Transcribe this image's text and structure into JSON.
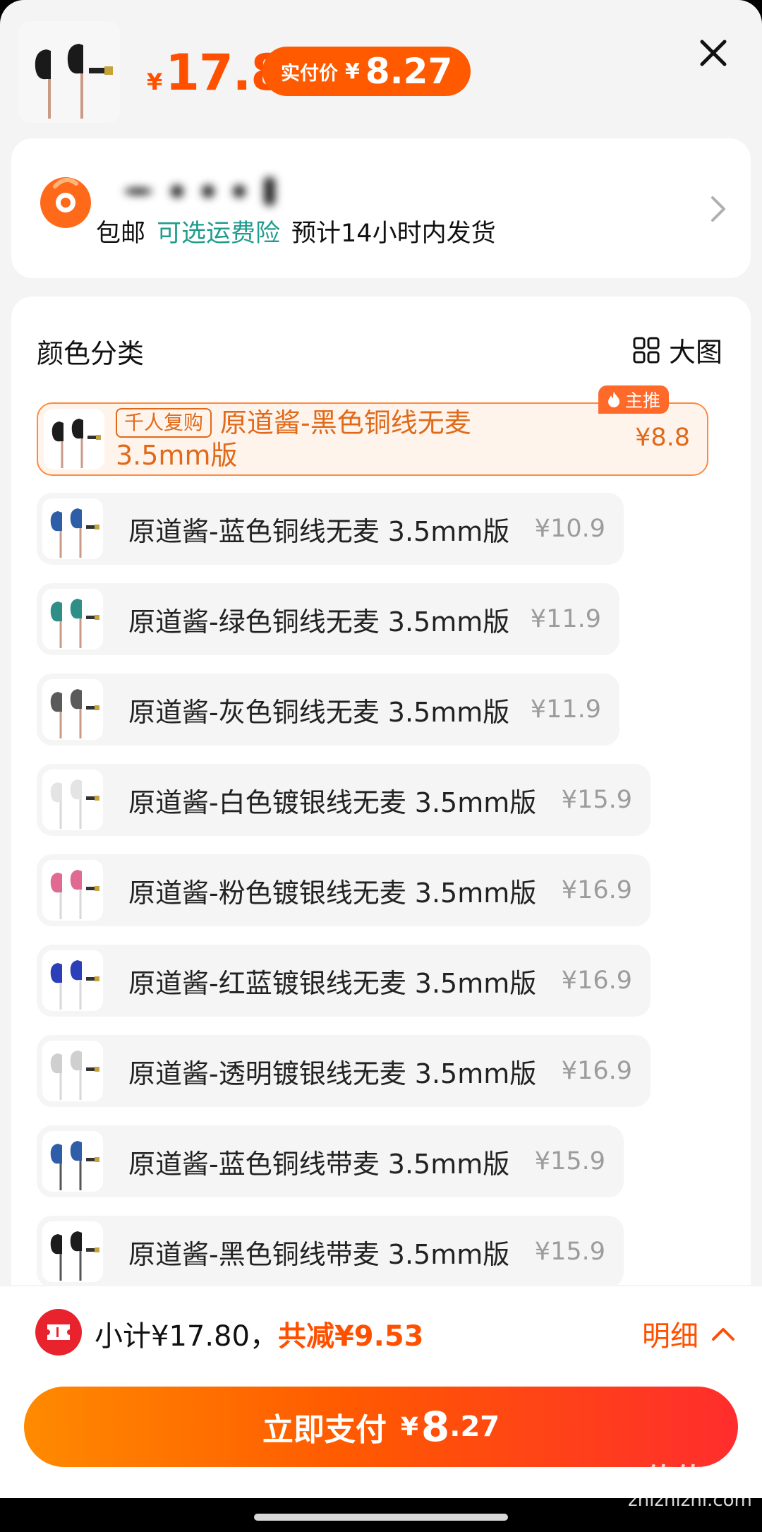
{
  "header": {
    "price_currency": "¥",
    "price": "17.8",
    "pay_label": "实付价",
    "pay_currency": "¥",
    "pay_price": "8.27"
  },
  "shipping": {
    "free_shipping": "包邮",
    "insurance": "可选运费险",
    "eta": "预计14小时内发货"
  },
  "options": {
    "section_title": "颜色分类",
    "big_view_label": "大图",
    "main_badge": "主推",
    "rebuy_tag": "千人复购",
    "items": [
      {
        "name": "原道酱-黑色铜线无麦\n3.5mm版",
        "price": "¥8.8",
        "swatch": "#1c1c1c",
        "wire": "#c99a86"
      },
      {
        "name": "原道酱-蓝色铜线无麦 3.5mm版",
        "price": "¥10.9",
        "swatch": "#2f5ea8",
        "wire": "#c99a86"
      },
      {
        "name": "原道酱-绿色铜线无麦 3.5mm版",
        "price": "¥11.9",
        "swatch": "#2f8f86",
        "wire": "#c99a86"
      },
      {
        "name": "原道酱-灰色铜线无麦 3.5mm版",
        "price": "¥11.9",
        "swatch": "#5a5a5a",
        "wire": "#c99a86"
      },
      {
        "name": "原道酱-白色镀银线无麦 3.5mm版",
        "price": "¥15.9",
        "swatch": "#e4e4e4",
        "wire": "#d8d8d8"
      },
      {
        "name": "原道酱-粉色镀银线无麦 3.5mm版",
        "price": "¥16.9",
        "swatch": "#e16a92",
        "wire": "#d8d8d8"
      },
      {
        "name": "原道酱-红蓝镀银线无麦 3.5mm版",
        "price": "¥16.9",
        "swatch": "#2a3fb8",
        "wire": "#d8d8d8"
      },
      {
        "name": "原道酱-透明镀银线无麦 3.5mm版",
        "price": "¥16.9",
        "swatch": "#cfcfcf",
        "wire": "#d8d8d8"
      },
      {
        "name": "原道酱-蓝色铜线带麦 3.5mm版",
        "price": "¥15.9",
        "swatch": "#2f5ea8",
        "wire": "#555555"
      },
      {
        "name": "原道酱-黑色铜线带麦 3.5mm版",
        "price": "¥15.9",
        "swatch": "#1c1c1c",
        "wire": "#555555"
      }
    ]
  },
  "footer": {
    "subtotal": "小计¥17.80，",
    "discount": "共减¥9.53",
    "detail_label": "明细",
    "pay_button_label": "立即支付",
    "pay_currency": "¥",
    "pay_int": "8",
    "pay_dec": ".27"
  },
  "watermark": {
    "main": "值值值",
    "site": "zhizhizhi.com"
  },
  "colors": {
    "accent": "#ff5000",
    "teal": "#1f9c8e",
    "muted_price": "#9c9c9c"
  }
}
